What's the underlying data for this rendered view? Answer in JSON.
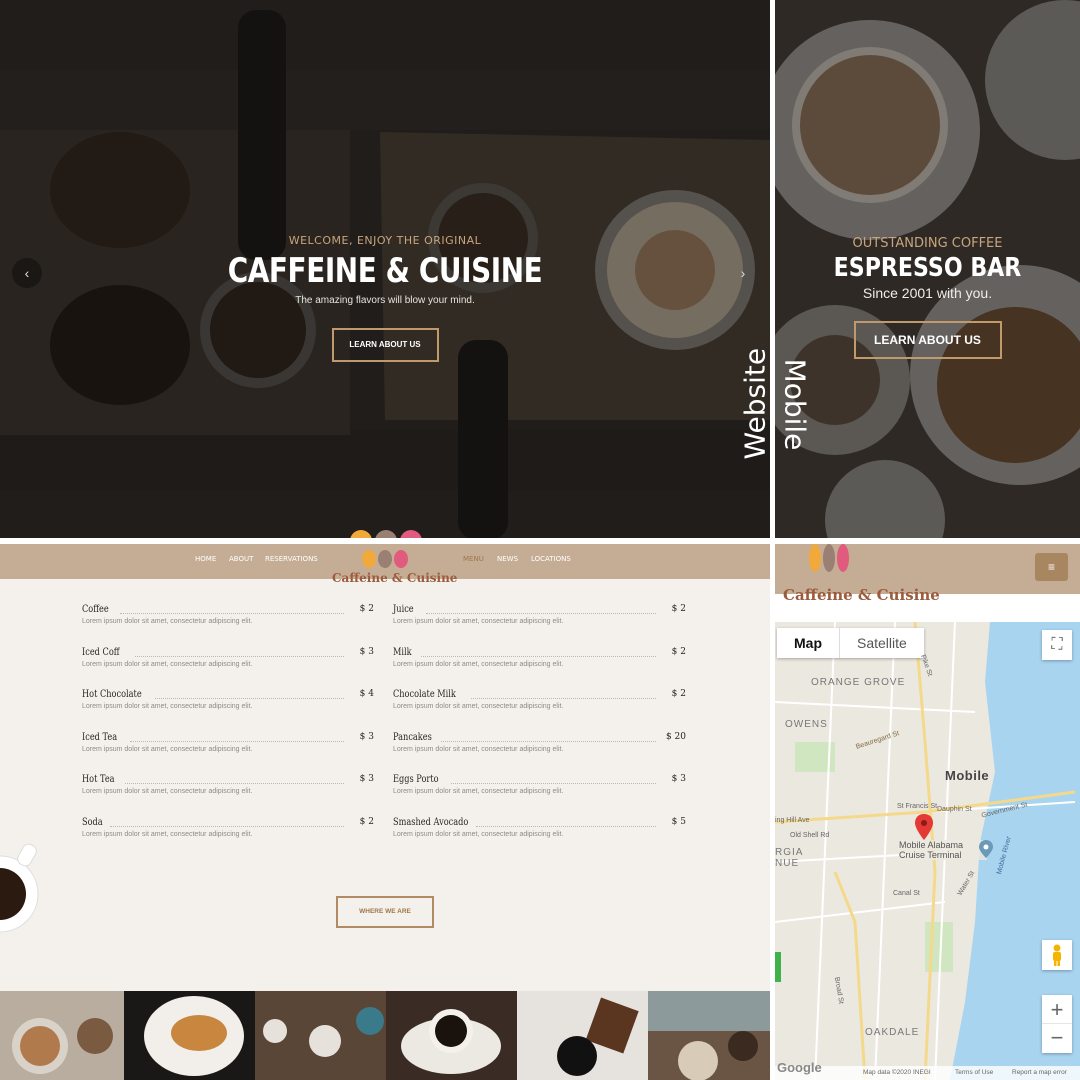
{
  "website_hero": {
    "subtitle": "WELCOME, ENJOY THE ORIGINAL",
    "title": "CAFFEINE & CUISINE",
    "tagline": "The amazing flavors will blow your mind.",
    "button": "LEARN ABOUT US",
    "prev_icon": "‹",
    "next_icon": "›"
  },
  "labels": {
    "website": "Website",
    "mobile": "Mobile"
  },
  "mobile_hero": {
    "subtitle": "OUTSTANDING COFFEE",
    "title": "ESPRESSO BAR",
    "tagline": "Since 2001 with you.",
    "button": "LEARN ABOUT US"
  },
  "nav": {
    "items": [
      "HOME",
      "ABOUT",
      "RESERVATIONS",
      "MENU",
      "NEWS",
      "LOCATIONS"
    ],
    "active": "MENU"
  },
  "logo": {
    "text": "Caffeine & Cuisine",
    "colors": [
      "#f2a93b",
      "#9a7f73",
      "#e05b7e"
    ]
  },
  "menu": {
    "description": "Lorem ipsum dolor sit amet, consectetur adipiscing elit.",
    "left": [
      {
        "name": "Coffee",
        "price": "$ 2"
      },
      {
        "name": "Iced Coff",
        "price": "$ 3"
      },
      {
        "name": "Hot Chocolate",
        "price": "$ 4"
      },
      {
        "name": "Iced Tea",
        "price": "$ 3"
      },
      {
        "name": "Hot Tea",
        "price": "$ 3"
      },
      {
        "name": "Soda",
        "price": "$ 2"
      }
    ],
    "right": [
      {
        "name": "Juice",
        "price": "$ 2"
      },
      {
        "name": "Milk",
        "price": "$ 2"
      },
      {
        "name": "Chocolate Milk",
        "price": "$ 2"
      },
      {
        "name": "Pancakes",
        "price": "$ 20"
      },
      {
        "name": "Eggs Porto",
        "price": "$ 3"
      },
      {
        "name": "Smashed Avocado",
        "price": "$ 5"
      }
    ],
    "where_button": "WHERE WE ARE"
  },
  "mobile_header": {
    "menu_icon": "≡"
  },
  "map": {
    "tab_map": "Map",
    "tab_satellite": "Satellite",
    "places": [
      "ORANGE GROVE",
      "OWENS",
      "Mobile",
      "Mobile Alabama Cruise Terminal",
      "OAKDALE",
      "RGIA NUE"
    ],
    "streets": [
      "Beauregard St",
      "St Francis St",
      "Dauphin St",
      "Government St",
      "Old Shell Rd",
      "ing Hill Ave",
      "Canal St",
      "Water St",
      "Mobile River",
      "Broad St",
      "Pike St"
    ],
    "footer_left": "Google",
    "footer_right": [
      "Map data ©2020 INEGI",
      "Terms of Use",
      "Report a map error"
    ],
    "zoom_in": "+",
    "zoom_out": "−",
    "fullscreen_icon": "⛶"
  },
  "colors": {
    "accent": "#c19a6b",
    "nav_bg": "#c5ad95",
    "menu_bg": "#f4f1ec"
  }
}
